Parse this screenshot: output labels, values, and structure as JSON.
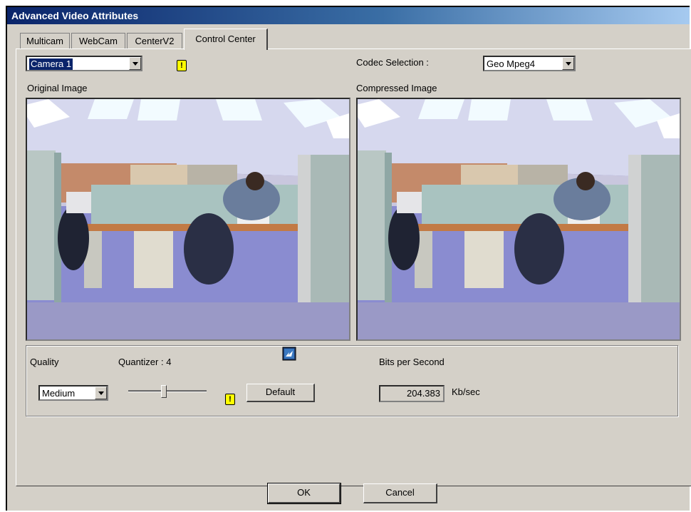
{
  "window": {
    "title": "Advanced Video Attributes"
  },
  "tabs": [
    {
      "label": "Multicam",
      "active": false
    },
    {
      "label": "WebCam",
      "active": false
    },
    {
      "label": "CenterV2",
      "active": false
    },
    {
      "label": "Control Center",
      "active": true
    }
  ],
  "camera_select": {
    "value": "Camera 1"
  },
  "codec": {
    "label": "Codec Selection :",
    "value": "Geo Mpeg4"
  },
  "images": {
    "original_label": "Original Image",
    "compressed_label": "Compressed Image"
  },
  "quality": {
    "label": "Quality",
    "value": "Medium"
  },
  "quantizer": {
    "label": "Quantizer : 4",
    "slider_level": 0.45
  },
  "default_button": "Default",
  "bitrate": {
    "label": "Bits per Second",
    "value": "204.383",
    "unit": "Kb/sec"
  },
  "buttons": {
    "ok": "OK",
    "cancel": "Cancel"
  },
  "icons": {
    "warning": "warning-icon",
    "export": "export-icon"
  },
  "colors": {
    "titlebar": "#0a246a",
    "selection": "#0a246a",
    "warning": "#ffff00"
  }
}
